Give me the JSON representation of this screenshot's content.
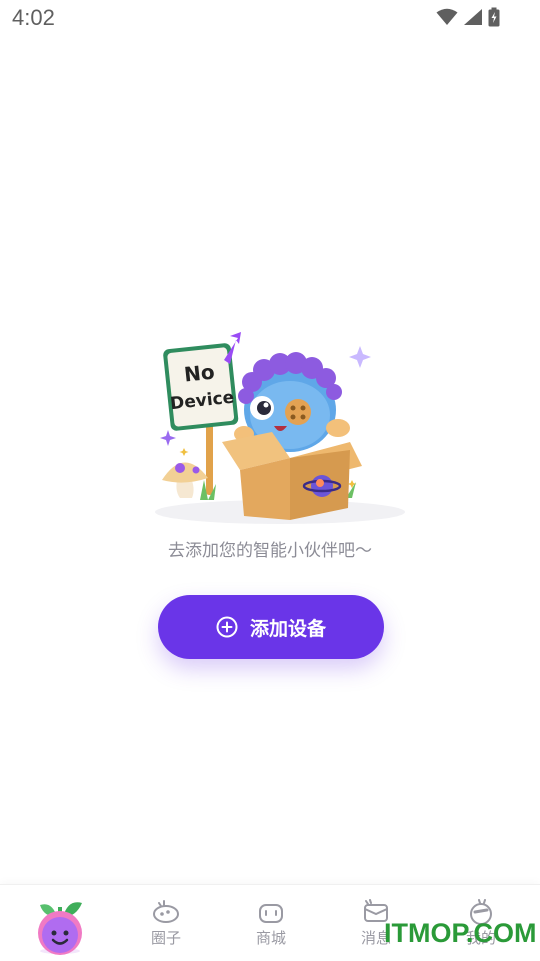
{
  "status_bar": {
    "time": "4:02",
    "icons": [
      "wifi-icon",
      "cell-signal-icon",
      "battery-charging-icon"
    ]
  },
  "empty_state": {
    "sign_line1": "No",
    "sign_line2": "Device",
    "message": "去添加您的智能小伙伴吧～"
  },
  "add_device": {
    "icon": "plus-circle-icon",
    "label": "添加设备"
  },
  "bottom_nav": {
    "items": [
      {
        "id": "home",
        "icon": "plant-pot-icon",
        "label": ""
      },
      {
        "id": "circle",
        "icon": "planet-icon",
        "label": "圈子"
      },
      {
        "id": "shop",
        "icon": "shop-icon",
        "label": "商城"
      },
      {
        "id": "messages",
        "icon": "envelope-icon",
        "label": "消息"
      },
      {
        "id": "mine",
        "icon": "profile-face-icon",
        "label": "我的"
      }
    ]
  },
  "watermark": "ITMOP.COM",
  "colors": {
    "accent": "#6a35e8",
    "nav_text": "#9a9aa3",
    "message_text": "#8c8c96",
    "watermark": "#2a9a38"
  }
}
